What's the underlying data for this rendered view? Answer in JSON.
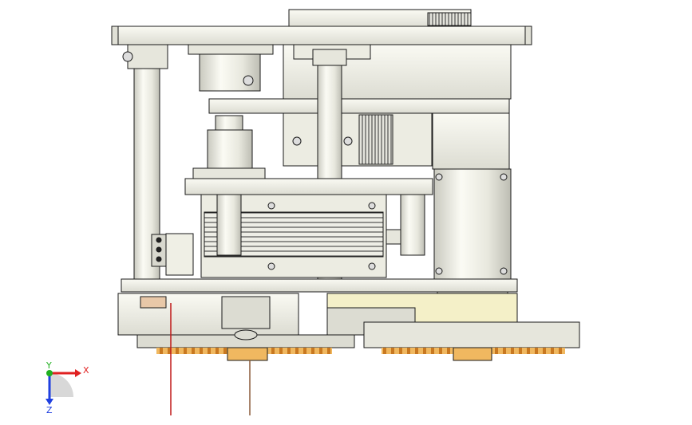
{
  "view": {
    "background": "#ffffff",
    "part_fill": "#f2f2ea",
    "part_shade": "#d6d6cc",
    "part_dark": "#a9a99f",
    "edge_color": "#1a1a1a",
    "accent_orange": "#e0a040",
    "accent_peach": "#e8c8a8",
    "accent_yellow": "#f4f0c8",
    "accent_red": "#c01818"
  },
  "triad": {
    "x_label": "X",
    "y_label": "Y",
    "z_label": "Z",
    "x_color": "#e02020",
    "y_color": "#20b020",
    "z_color": "#2040e0"
  }
}
